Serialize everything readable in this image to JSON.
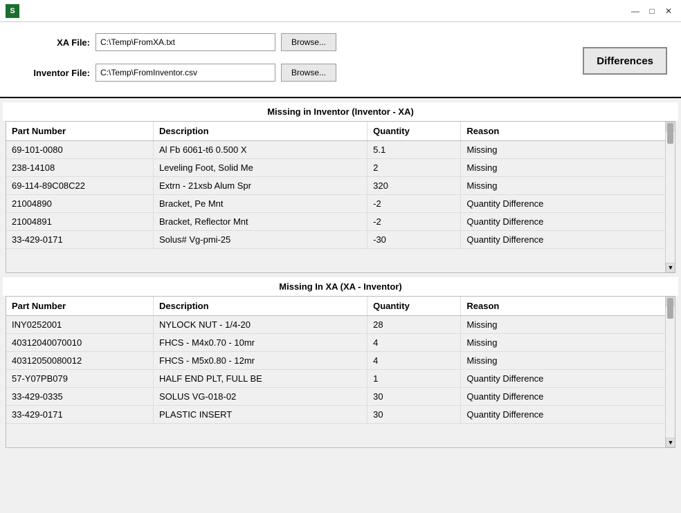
{
  "titlebar": {
    "app_icon": "S",
    "minimize_label": "—",
    "maximize_label": "□",
    "close_label": "✕"
  },
  "form": {
    "xa_file_label": "XA File:",
    "xa_file_value": "C:\\Temp\\FromXA.txt",
    "inventor_file_label": "Inventor File:",
    "inventor_file_value": "C:\\Temp\\FromInventor.csv",
    "browse_label": "Browse...",
    "differences_label": "Differences"
  },
  "table1": {
    "section_header": "Missing in Inventor (Inventor - XA)",
    "columns": [
      "Part Number",
      "Description",
      "Quantity",
      "Reason"
    ],
    "rows": [
      [
        "69-101-0080",
        "Al Fb 6061-t6    0.500 X",
        "5.1",
        "Missing"
      ],
      [
        "238-14108",
        "Leveling Foot, Solid Me",
        "2",
        "Missing"
      ],
      [
        "69-114-89C08C22",
        "Extrn - 21xsb Alum Spr",
        "320",
        "Missing"
      ],
      [
        "21004890",
        "Bracket, Pe Mnt",
        "-2",
        "Quantity Difference"
      ],
      [
        "21004891",
        "Bracket, Reflector Mnt",
        "-2",
        "Quantity Difference"
      ],
      [
        "33-429-0171",
        "Solus# Vg-pmi-25",
        "-30",
        "Quantity Difference"
      ]
    ]
  },
  "table2": {
    "section_header": "Missing In XA (XA - Inventor)",
    "columns": [
      "Part Number",
      "Description",
      "Quantity",
      "Reason"
    ],
    "rows": [
      [
        "INY0252001",
        "NYLOCK NUT - 1/4-20",
        "28",
        "Missing"
      ],
      [
        "40312040070010",
        "FHCS - M4x0.70 - 10mr",
        "4",
        "Missing"
      ],
      [
        "40312050080012",
        "FHCS - M5x0.80 - 12mr",
        "4",
        "Missing"
      ],
      [
        "57-Y07PB079",
        "HALF END PLT, FULL BE",
        "1",
        "Quantity Difference"
      ],
      [
        "33-429-0335",
        "SOLUS VG-018-02",
        "30",
        "Quantity Difference"
      ],
      [
        "33-429-0171",
        "PLASTIC INSERT",
        "30",
        "Quantity Difference"
      ]
    ]
  }
}
